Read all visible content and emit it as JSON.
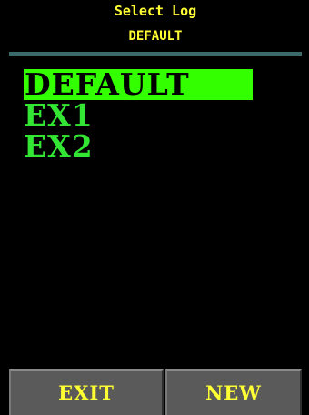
{
  "header": {
    "title": "Select Log",
    "current_log": "DEFAULT"
  },
  "logs": {
    "items": [
      {
        "label": "DEFAULT",
        "selected": true
      },
      {
        "label": "EX1",
        "selected": false
      },
      {
        "label": "EX2",
        "selected": false
      }
    ]
  },
  "buttons": {
    "exit_label": "EXIT",
    "new_label": "NEW"
  },
  "colors": {
    "background": "#000000",
    "header_text": "#ffff33",
    "divider": "#3c6a6a",
    "list_text": "#33e633",
    "selection_highlight": "#33ff00",
    "button_face": "#5a5a5a",
    "button_text": "#ffff33"
  }
}
